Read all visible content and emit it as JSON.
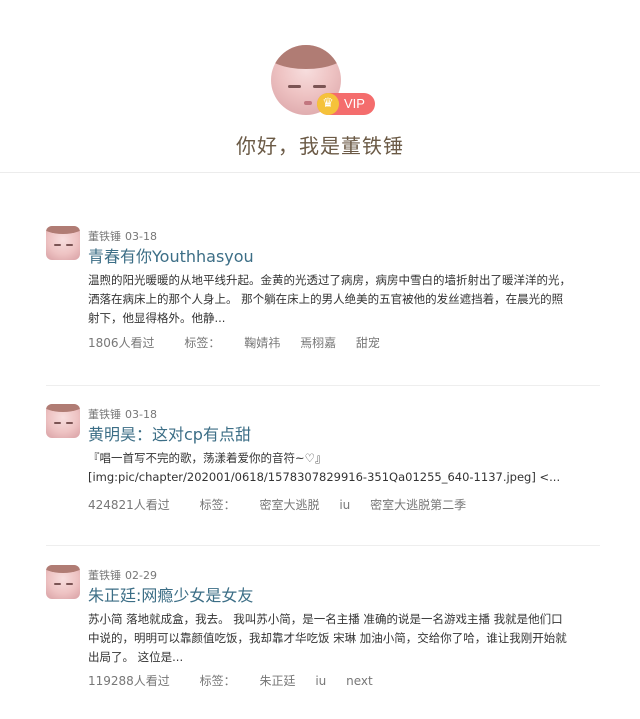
{
  "profile": {
    "badge": "VIP",
    "greeting": "你好，我是董铁锤"
  },
  "posts": [
    {
      "author": "董铁锤",
      "date": "03-18",
      "title": "青春有你Youthhasyou",
      "excerpt": [
        "温煦的阳光暖暖的从地平线升起。金黄的光透过了病房，病房中雪白的墙折射出了暖洋洋的光，",
        "洒落在病床上的那个人身上。 那个躺在床上的男人绝美的五官被他的发丝遮挡着，在晨光的照",
        "射下，他显得格外。他静..."
      ],
      "views": "1806人看过",
      "tag_label": "标签：",
      "tags": [
        "鞠婧祎",
        "焉栩嘉",
        "甜宠"
      ]
    },
    {
      "author": "董铁锤",
      "date": "03-18",
      "title": "黄明昊：这对cp有点甜",
      "excerpt": [
        "『唱一首写不完的歌，荡漾着爱你的音符~♡』",
        "[img:pic/chapter/202001/0618/1578307829916-351Qa01255_640-1137.jpeg] <..."
      ],
      "views": "424821人看过",
      "tag_label": "标签：",
      "tags": [
        "密室大逃脱",
        "iu",
        "密室大逃脱第二季"
      ]
    },
    {
      "author": "董铁锤",
      "date": "02-29",
      "title": "朱正廷:网瘾少女是女友",
      "excerpt": [
        "苏小简 落地就成盒，我去。 我叫苏小简，是一名主播 准确的说是一名游戏主播 我就是他们口",
        "中说的，明明可以靠颜值吃饭，我却靠才华吃饭 宋琳 加油小简，交给你了哈，谁让我刚开始就",
        "出局了。 这位是..."
      ],
      "views": "119288人看过",
      "tag_label": "标签：",
      "tags": [
        "朱正廷",
        "iu",
        "next"
      ]
    }
  ]
}
